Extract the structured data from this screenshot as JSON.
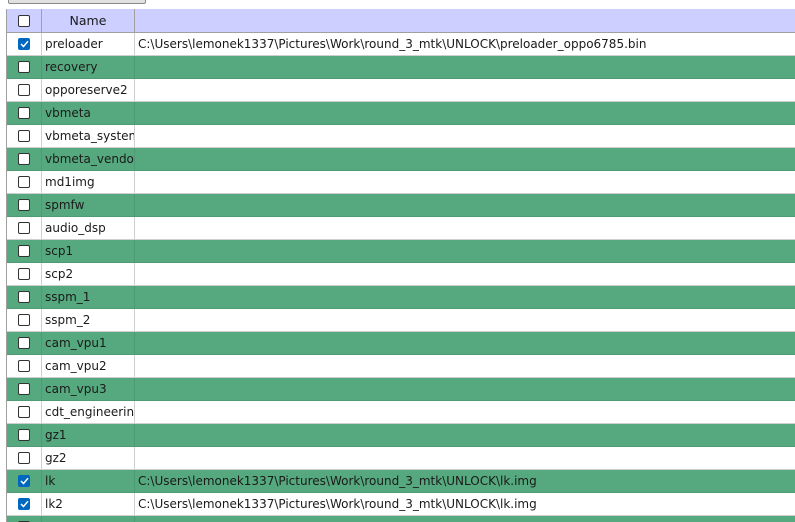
{
  "header": {
    "name_label": "Name",
    "select_all_checked": false
  },
  "rows": [
    {
      "name": "preloader",
      "checked": true,
      "file": "C:\\Users\\lemonek1337\\Pictures\\Work\\round_3_mtk\\UNLOCK\\preloader_oppo6785.bin"
    },
    {
      "name": "recovery",
      "checked": false,
      "file": ""
    },
    {
      "name": "opporeserve2",
      "checked": false,
      "file": ""
    },
    {
      "name": "vbmeta",
      "checked": false,
      "file": ""
    },
    {
      "name": "vbmeta_system",
      "checked": false,
      "file": ""
    },
    {
      "name": "vbmeta_vendor",
      "checked": false,
      "file": ""
    },
    {
      "name": "md1img",
      "checked": false,
      "file": ""
    },
    {
      "name": "spmfw",
      "checked": false,
      "file": ""
    },
    {
      "name": "audio_dsp",
      "checked": false,
      "file": ""
    },
    {
      "name": "scp1",
      "checked": false,
      "file": ""
    },
    {
      "name": "scp2",
      "checked": false,
      "file": ""
    },
    {
      "name": "sspm_1",
      "checked": false,
      "file": ""
    },
    {
      "name": "sspm_2",
      "checked": false,
      "file": ""
    },
    {
      "name": "cam_vpu1",
      "checked": false,
      "file": ""
    },
    {
      "name": "cam_vpu2",
      "checked": false,
      "file": ""
    },
    {
      "name": "cam_vpu3",
      "checked": false,
      "file": ""
    },
    {
      "name": "cdt_engineering",
      "checked": false,
      "file": ""
    },
    {
      "name": "gz1",
      "checked": false,
      "file": ""
    },
    {
      "name": "gz2",
      "checked": false,
      "file": ""
    },
    {
      "name": "lk",
      "checked": true,
      "file": "C:\\Users\\lemonek1337\\Pictures\\Work\\round_3_mtk\\UNLOCK\\lk.img"
    },
    {
      "name": "lk2",
      "checked": true,
      "file": "C:\\Users\\lemonek1337\\Pictures\\Work\\round_3_mtk\\UNLOCK\\lk.img"
    },
    {
      "name": "",
      "checked": false,
      "file": ""
    }
  ],
  "colors": {
    "header_bg": "#cccfff",
    "alt_row_bg": "#56a97e",
    "checked_bg": "#0067c0"
  }
}
